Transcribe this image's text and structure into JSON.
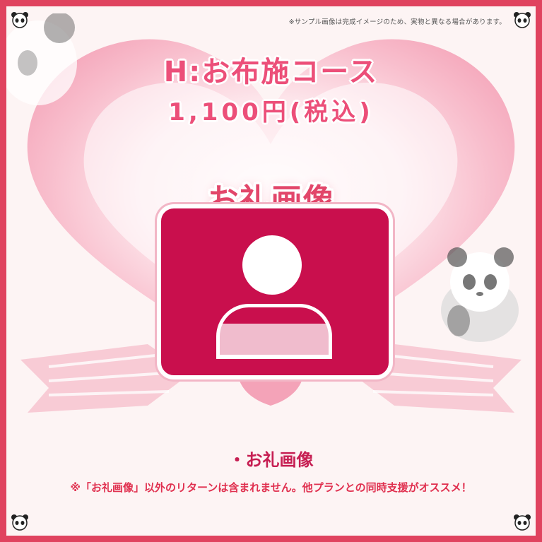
{
  "notice": "※サンプル画像は完成イメージのため、実物と異なる場合があります。",
  "course": {
    "title": "H:お布施コース",
    "price": "1,100円(税込)"
  },
  "reward": {
    "label": "お礼画像",
    "placeholder_icon": "person-icon"
  },
  "items": [
    "・お礼画像"
  ],
  "footnote": "※「お礼画像」以外のリターンは含まれません。他プランとの同時支援がオススメ！",
  "colors": {
    "border": "#e0435f",
    "accent": "#ec4f79",
    "photo_box": "#c90f4d",
    "text_dark": "#c61e52",
    "note": "#e0304f"
  },
  "decorations": [
    "heart-background",
    "ribbon",
    "panda-icon"
  ]
}
